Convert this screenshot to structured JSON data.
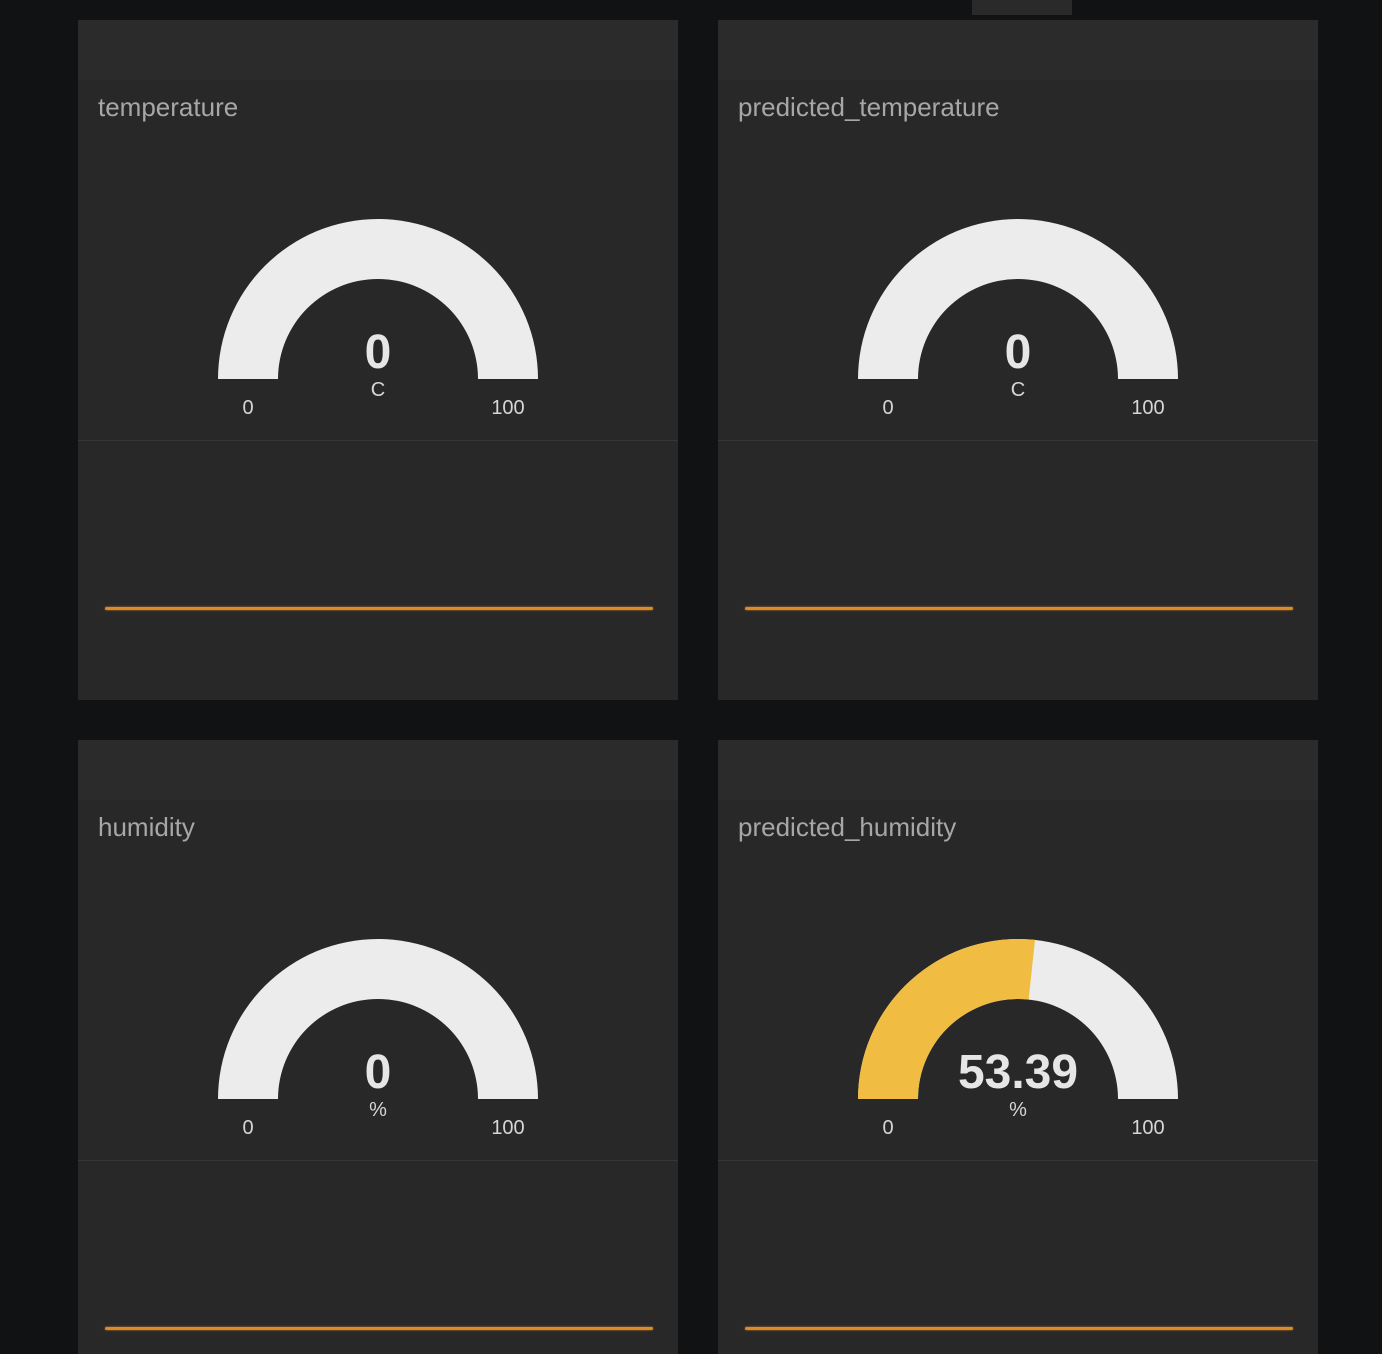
{
  "colors": {
    "background": "#111214",
    "card": "#282828",
    "gauge_track": "#edecec",
    "gauge_fill": "#f0bc41",
    "chart_line": "#e08a25",
    "title_text": "#a7a7a7"
  },
  "widgets": [
    {
      "title": "temperature",
      "gauge": {
        "value": 0,
        "value_text": "0",
        "units": "C",
        "min": 0,
        "max": 100,
        "min_label": "0",
        "max_label": "100"
      },
      "chart": {
        "type": "line",
        "values": [
          0,
          0
        ]
      }
    },
    {
      "title": "predicted_temperature",
      "gauge": {
        "value": 0,
        "value_text": "0",
        "units": "C",
        "min": 0,
        "max": 100,
        "min_label": "0",
        "max_label": "100"
      },
      "chart": {
        "type": "line",
        "values": [
          0,
          0
        ]
      }
    },
    {
      "title": "humidity",
      "gauge": {
        "value": 0,
        "value_text": "0",
        "units": "%",
        "min": 0,
        "max": 100,
        "min_label": "0",
        "max_label": "100"
      },
      "chart": {
        "type": "line",
        "values": [
          0,
          0
        ]
      }
    },
    {
      "title": "predicted_humidity",
      "gauge": {
        "value": 53.39,
        "value_text": "53.39",
        "units": "%",
        "min": 0,
        "max": 100,
        "min_label": "0",
        "max_label": "100"
      },
      "chart": {
        "type": "line",
        "values": [
          53.39,
          53.39
        ]
      }
    }
  ]
}
